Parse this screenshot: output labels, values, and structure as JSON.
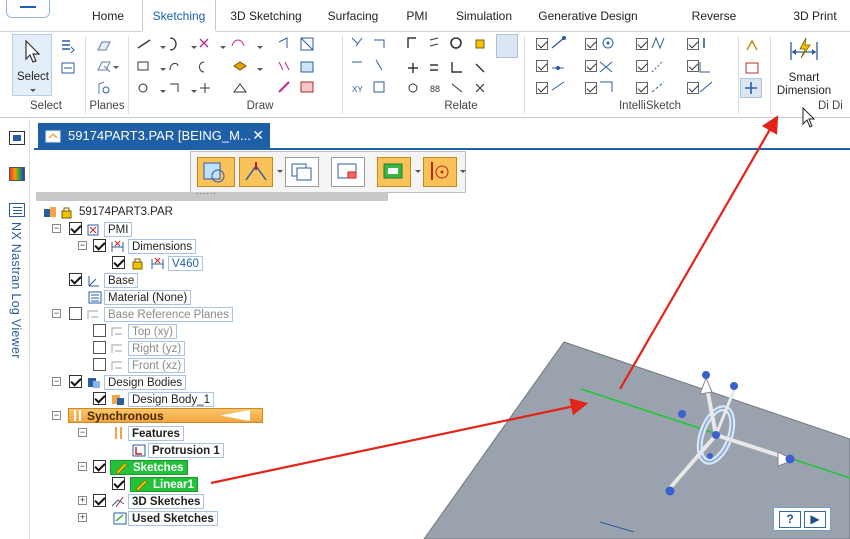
{
  "ribbon": {
    "tabs": [
      "Home",
      "Sketching",
      "3D Sketching",
      "Surfacing",
      "PMI",
      "Simulation",
      "Generative Design",
      "Reverse Engineering",
      "3D Print"
    ],
    "active_tab": "Sketching",
    "groups": {
      "select": {
        "label": "Select",
        "button": "Select"
      },
      "planes": {
        "label": "Planes"
      },
      "draw": {
        "label": "Draw"
      },
      "relate": {
        "label": "Relate"
      },
      "intellisketch": {
        "label": "IntelliSketch"
      },
      "dimension": {
        "label": "Di",
        "button_line1": "Smart",
        "button_line2": "Dimension",
        "extra_label": "Di"
      }
    }
  },
  "side_panel": {
    "label": "NX Nastran Log Viewer"
  },
  "document": {
    "tab_title": "59174PART3.PAR [BEING_M...",
    "close": "✕"
  },
  "tree": {
    "root": "59174PART3.PAR",
    "pmi": "PMI",
    "dimensions": "Dimensions",
    "v460": "V460",
    "base": "Base",
    "material": "Material (None)",
    "base_ref_planes": "Base Reference Planes",
    "top": "Top (xy)",
    "right": "Right (yz)",
    "front": "Front (xz)",
    "design_bodies": "Design Bodies",
    "design_body_1": "Design Body_1",
    "synchronous": "Synchronous",
    "features": "Features",
    "protrusion_1": "Protrusion 1",
    "sketches": "Sketches",
    "linear1": "Linear1",
    "sketches_3d": "3D Sketches",
    "used_sketches": "Used Sketches"
  },
  "help": {
    "help_label": "?",
    "play_label": "▶"
  },
  "colors": {
    "accent": "#1f5fa8",
    "sketch_green": "#24c23a",
    "synchronous_orange": "#f2a540",
    "arrow_red": "#e3241b",
    "plane_grey": "#9aa3ad"
  },
  "icons": [
    "select-arrow-icon",
    "smart-dimension-icon",
    "steering-wheel-icon",
    "help-icon",
    "play-icon",
    "close-icon"
  ]
}
